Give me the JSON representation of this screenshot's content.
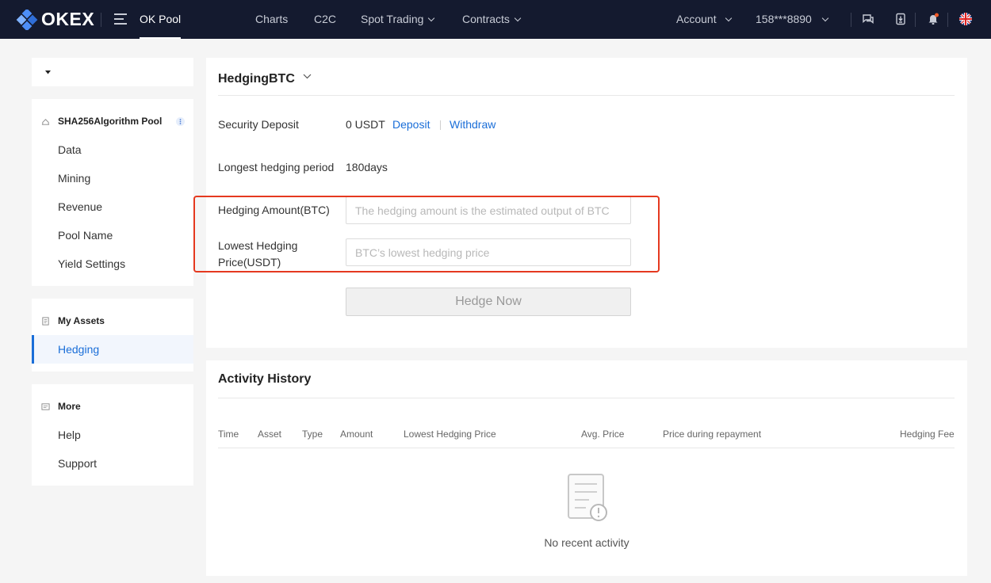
{
  "nav": {
    "brand": "OKEX",
    "pool": "OK Pool",
    "links": [
      "Charts",
      "C2C",
      "Spot Trading",
      "Contracts"
    ],
    "account": "Account",
    "phone": "158***8890"
  },
  "sidebar": {
    "dropdown_label": "",
    "pool_section": {
      "title": "SHA256Algorithm Pool",
      "items": [
        "Data",
        "Mining",
        "Revenue",
        "Pool Name",
        "Yield Settings"
      ]
    },
    "assets_section": {
      "title": "My Assets",
      "items": [
        "Hedging"
      ]
    },
    "more_section": {
      "title": "More",
      "items": [
        "Help",
        "Support"
      ]
    }
  },
  "hedging": {
    "title": "HedgingBTC",
    "security_deposit_label": "Security Deposit",
    "security_deposit_value": "0 USDT",
    "deposit_link": "Deposit",
    "withdraw_link": "Withdraw",
    "period_label": "Longest hedging period",
    "period_value": "180days",
    "amount_label": "Hedging Amount(BTC)",
    "amount_placeholder": "The hedging amount is the estimated output of BTC",
    "price_label_line1": "Lowest Hedging",
    "price_label_line2": "Price(USDT)",
    "price_placeholder": "BTC’s lowest hedging price",
    "button": "Hedge Now"
  },
  "activity": {
    "title": "Activity History",
    "columns": [
      "Time",
      "Asset",
      "Type",
      "Amount",
      "Lowest Hedging Price",
      "Avg. Price",
      "Price during repayment",
      "Hedging Fee"
    ],
    "empty": "No recent activity"
  },
  "colors": {
    "nav_bg": "#141a2f",
    "accent": "#1a6ed8",
    "highlight_box": "#e5391f"
  }
}
